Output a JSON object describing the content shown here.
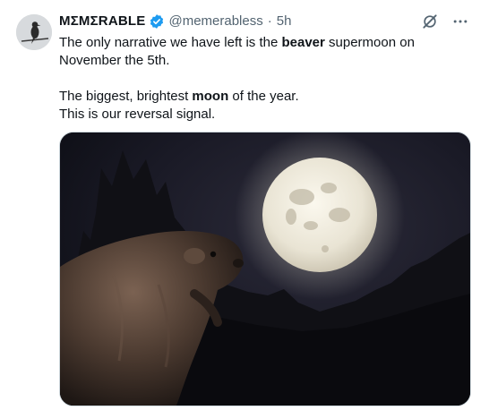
{
  "author": {
    "display_name": "MΣMΣRABLE",
    "handle": "@memerabless",
    "separator": "·",
    "timestamp": "5h"
  },
  "icons": {
    "verified": "verified-badge-icon",
    "grok": "grok-icon",
    "more": "more-icon"
  },
  "colors": {
    "verified": "#1d9bf0",
    "text": "#0f1419",
    "secondary": "#536471"
  },
  "tweet": {
    "line1_pre": "The only narrative we have left is the ",
    "line1_bold": "beaver",
    "line1_post": " supermoon on November the 5th.",
    "line2_pre": "The biggest, brightest ",
    "line2_bold": "moon",
    "line2_post": " of the year.",
    "line3": "This is our reversal signal."
  },
  "media": {
    "subject": "beaver in front of a full moon at night"
  }
}
